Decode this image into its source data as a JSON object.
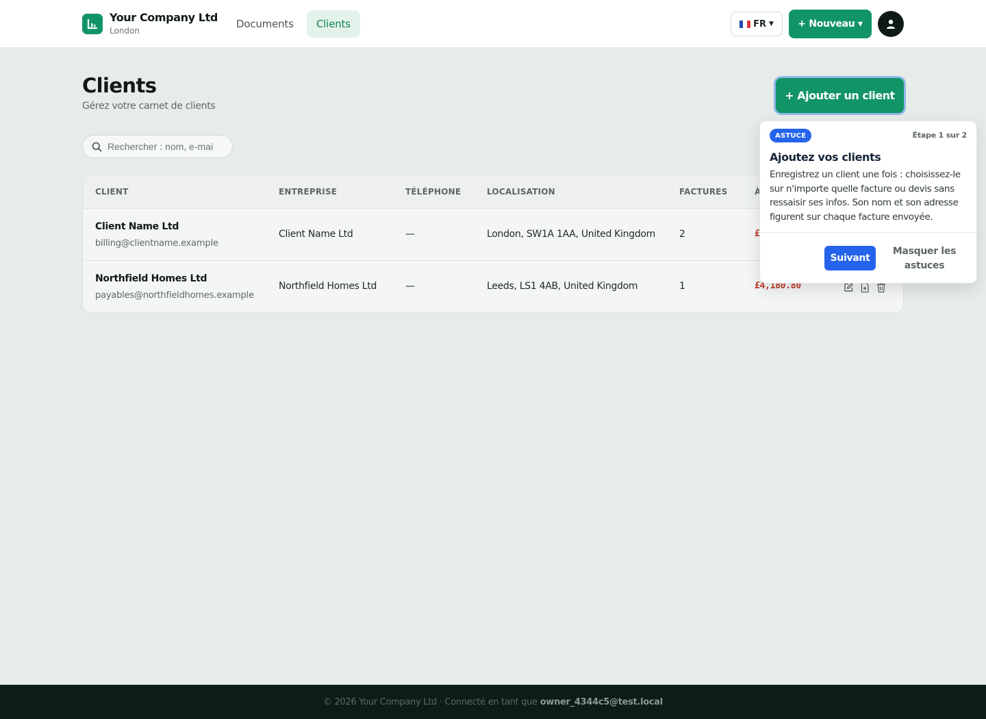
{
  "header": {
    "company_name": "Your Company Ltd",
    "company_city": "London",
    "nav": [
      {
        "label": "Documents",
        "active": false
      },
      {
        "label": "Clients",
        "active": true
      }
    ],
    "language": "FR",
    "new_button": "+ Nouveau ▾",
    "icons": [
      "chart-logo-icon",
      "france-flag-icon",
      "user-icon"
    ]
  },
  "page": {
    "title": "Clients",
    "subtitle": "Gérez votre carnet de clients",
    "add_button": "+ Ajouter un client",
    "search_placeholder": "Rechercher : nom, e-mai"
  },
  "table": {
    "headers": [
      "CLIENT",
      "ENTREPRISE",
      "TÉLÉPHONE",
      "LOCALISATION",
      "FACTURES",
      "À"
    ],
    "rows": [
      {
        "name": "Client Name Ltd",
        "email": "billing@clientname.example",
        "company": "Client Name Ltd",
        "phone": "—",
        "location": "London, SW1A 1AA, United Kingdom",
        "invoices": "2",
        "due": "£"
      },
      {
        "name": "Northfield Homes Ltd",
        "email": "payables@northfieldhomes.example",
        "company": "Northfield Homes Ltd",
        "phone": "—",
        "location": "Leeds, LS1 4AB, United Kingdom",
        "invoices": "1",
        "due": "£4,180.80"
      }
    ],
    "row_action_icons": [
      "edit-icon",
      "new-document-icon",
      "trash-icon"
    ]
  },
  "tour": {
    "badge": "ASTUCE",
    "step": "Étape 1 sur 2",
    "title": "Ajoutez vos clients",
    "text": "Enregistrez un client une fois : choisissez-le sur n'importe quelle facture ou devis sans ressaisir ses infos. Son nom et son adresse figurent sur chaque facture envoyée.",
    "next": "Suivant",
    "hide": "Masquer les astuces"
  },
  "footer": {
    "text": "© 2026 Your Company Ltd · Connecté en tant que",
    "user": "owner_4344c5@test.local"
  },
  "colors": {
    "brand_green": "#129566",
    "tour_blue": "#2563eb",
    "amount_due_red": "#c0392b",
    "footer_bg": "#0c1c16"
  }
}
